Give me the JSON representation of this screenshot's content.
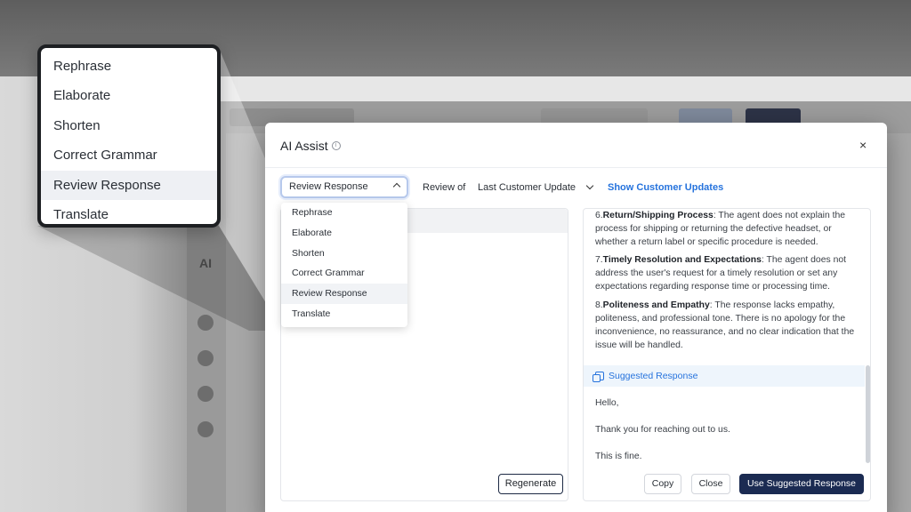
{
  "modal": {
    "title": "AI Assist",
    "close_glyph": "×",
    "info_glyph": "i",
    "action_select": {
      "value": "Review Response"
    },
    "review_of_label": "Review of",
    "review_of_value": "Last Customer Update",
    "show_updates_link": "Show Customer Updates",
    "dropdown_options": [
      "Rephrase",
      "Elaborate",
      "Shorten",
      "Correct Grammar",
      "Review Response",
      "Translate"
    ],
    "dropdown_selected": "Review Response",
    "regenerate_label": "Regenerate",
    "review_items": [
      {
        "num": "6.",
        "heading": "Return/Shipping Process",
        "text": ": The agent does not explain the process for shipping or returning the defective headset, or whether a return label or specific procedure is needed."
      },
      {
        "num": "7.",
        "heading": "Timely Resolution and Expectations",
        "text": ": The agent does not address the user's request for a timely resolution or set any expectations regarding response time or processing time."
      },
      {
        "num": "8.",
        "heading": "Politeness and Empathy",
        "text": ": The response lacks empathy, politeness, and professional tone. There is no apology for the inconvenience, no reassurance, and no clear indication that the issue will be handled."
      }
    ],
    "suggested_heading": "Suggested Response",
    "suggested_lines": [
      "Hello,",
      "Thank you for reaching out to us.",
      "This is fine."
    ],
    "copy_label": "Copy",
    "close_label": "Close",
    "use_label": "Use Suggested Response"
  },
  "callout": {
    "options": [
      "Rephrase",
      "Elaborate",
      "Shorten",
      "Correct Grammar",
      "Review Response",
      "Translate"
    ],
    "selected": "Review Response"
  },
  "background": {
    "sidebar_ai_label": "AI"
  },
  "colors": {
    "accent": "#2673dd",
    "primary_button": "#1b2b52",
    "selected_row": "#f1f3f6"
  }
}
